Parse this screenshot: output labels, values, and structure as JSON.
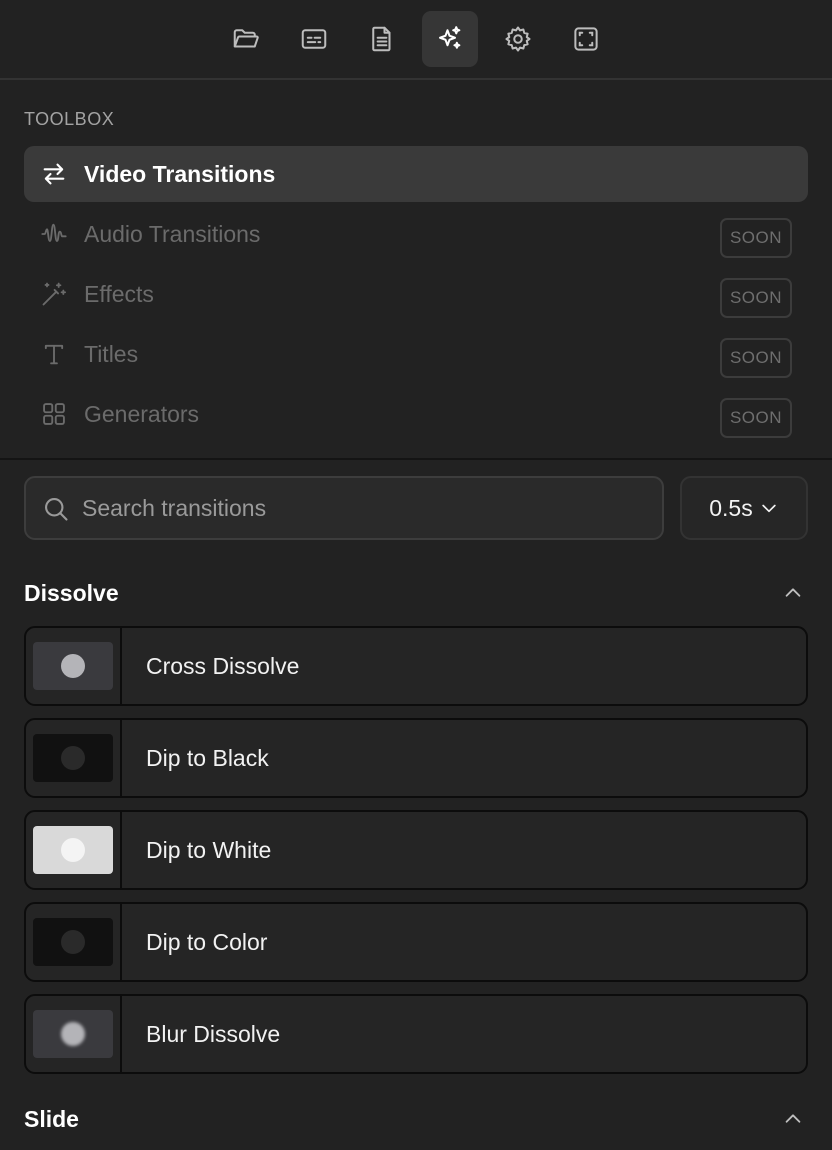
{
  "topbar": {
    "tabs": [
      {
        "icon": "folder-open-icon",
        "active": false
      },
      {
        "icon": "subtitles-icon",
        "active": false
      },
      {
        "icon": "document-icon",
        "active": false
      },
      {
        "icon": "sparkles-icon",
        "active": true
      },
      {
        "icon": "gear-icon",
        "active": false
      },
      {
        "icon": "frame-icon",
        "active": false
      }
    ]
  },
  "toolbox": {
    "label": "TOOLBOX",
    "items": [
      {
        "label": "Video Transitions",
        "icon": "arrows-left-right-icon",
        "active": true,
        "badge": ""
      },
      {
        "label": "Audio Transitions",
        "icon": "waveform-icon",
        "active": false,
        "badge": "SOON"
      },
      {
        "label": "Effects",
        "icon": "magic-wand-icon",
        "active": false,
        "badge": "SOON"
      },
      {
        "label": "Titles",
        "icon": "text-icon",
        "active": false,
        "badge": "SOON"
      },
      {
        "label": "Generators",
        "icon": "grid-icon",
        "active": false,
        "badge": "SOON"
      }
    ]
  },
  "search": {
    "placeholder": "Search transitions",
    "value": ""
  },
  "duration": {
    "value": "0.5s"
  },
  "sections": [
    {
      "title": "Dissolve",
      "expanded": true,
      "items": [
        {
          "label": "Cross Dissolve",
          "thumb_bg": "#3a3a3e",
          "dot": "#b4b4b8"
        },
        {
          "label": "Dip to Black",
          "thumb_bg": "#111111",
          "dot": "#2a2a2a"
        },
        {
          "label": "Dip to White",
          "thumb_bg": "#d9d9d9",
          "dot": "#f4f4f4"
        },
        {
          "label": "Dip to Color",
          "thumb_bg": "#111111",
          "dot": "#2a2a2a"
        },
        {
          "label": "Blur Dissolve",
          "thumb_bg": "#3a3a3e",
          "dot": "#b4b4b8"
        }
      ]
    },
    {
      "title": "Slide",
      "expanded": true,
      "items": []
    }
  ],
  "colors": {
    "background": "#222222",
    "active_item": "#3a3a3a",
    "muted_text": "#6b6b6b"
  }
}
